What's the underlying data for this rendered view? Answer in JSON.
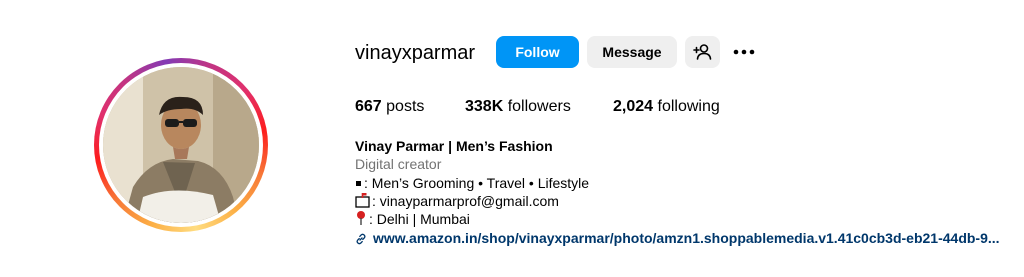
{
  "profile": {
    "username": "vinayxparmar",
    "follow_label": "Follow",
    "message_label": "Message",
    "suggest_icon": "add-person-icon",
    "more_icon": "more-options-icon"
  },
  "stats": {
    "posts_count": "667",
    "posts_label": "posts",
    "followers_count": "338K",
    "followers_label": "followers",
    "following_count": "2,024",
    "following_label": "following"
  },
  "bio": {
    "full_name": "Vinay Parmar | Men’s Fashion",
    "category": "Digital creator",
    "line1": ": Men’s Grooming • Travel • Lifestyle",
    "line2": ": vinayparmarprof@gmail.com",
    "line3": ": Delhi | Mumbai",
    "link": "www.amazon.in/shop/vinayxparmar/photo/amzn1.shoppablemedia.v1.41c0cb3d-eb21-44db-9..."
  },
  "colors": {
    "follow_bg": "#0095f6",
    "secondary_bg": "#efefef",
    "link": "#00376b",
    "muted": "#737373"
  }
}
